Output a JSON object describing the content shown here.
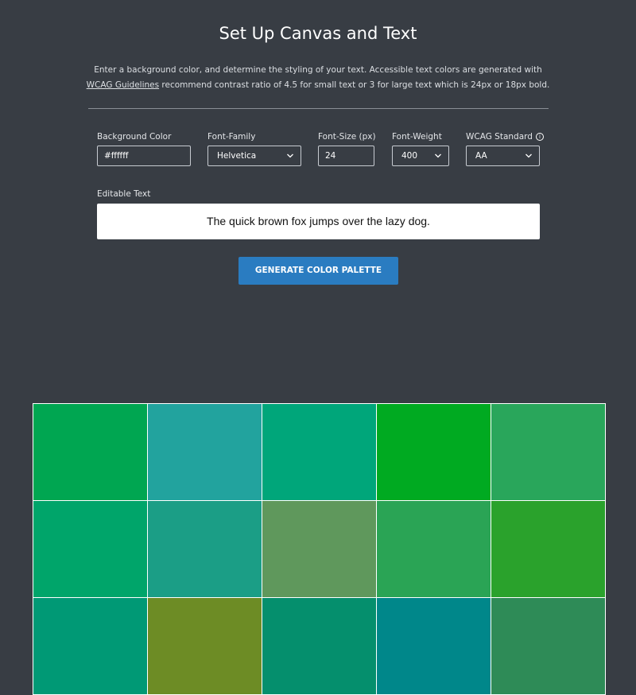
{
  "header": {
    "title": "Set Up Canvas and Text",
    "description_line1": "Enter a background color, and determine the styling of your text. Accessible text colors are generated with",
    "wcag_link": "WCAG Guidelines",
    "description_line2": " recommend contrast ratio of 4.5 for small text or 3 for large text which is 24px or 18px bold."
  },
  "form": {
    "background_color": {
      "label": "Background Color",
      "value": "#ffffff"
    },
    "font_family": {
      "label": "Font-Family",
      "value": "Helvetica"
    },
    "font_size": {
      "label": "Font-Size (px)",
      "value": "24"
    },
    "font_weight": {
      "label": "Font-Weight",
      "value": "400"
    },
    "wcag_standard": {
      "label": "WCAG Standard",
      "value": "AA",
      "info_icon": "ⓘ"
    },
    "editable_text": {
      "label": "Editable Text",
      "value": "The quick brown fox jumps over the lazy dog."
    },
    "generate_button": "GENERATE COLOR PALETTE"
  },
  "palette": {
    "swatches": [
      "#00a651",
      "#22a39e",
      "#00a67a",
      "#00aa21",
      "#29a65b",
      "#00a56a",
      "#1b9e86",
      "#5f985c",
      "#2aa455",
      "#2aa22c",
      "#009975",
      "#6d8c25",
      "#058f6d",
      "#00878a",
      "#2e8b57"
    ]
  },
  "colors": {
    "page_background": "#383d44",
    "button": "#2a7cc1",
    "text_box_background": "#ffffff"
  }
}
